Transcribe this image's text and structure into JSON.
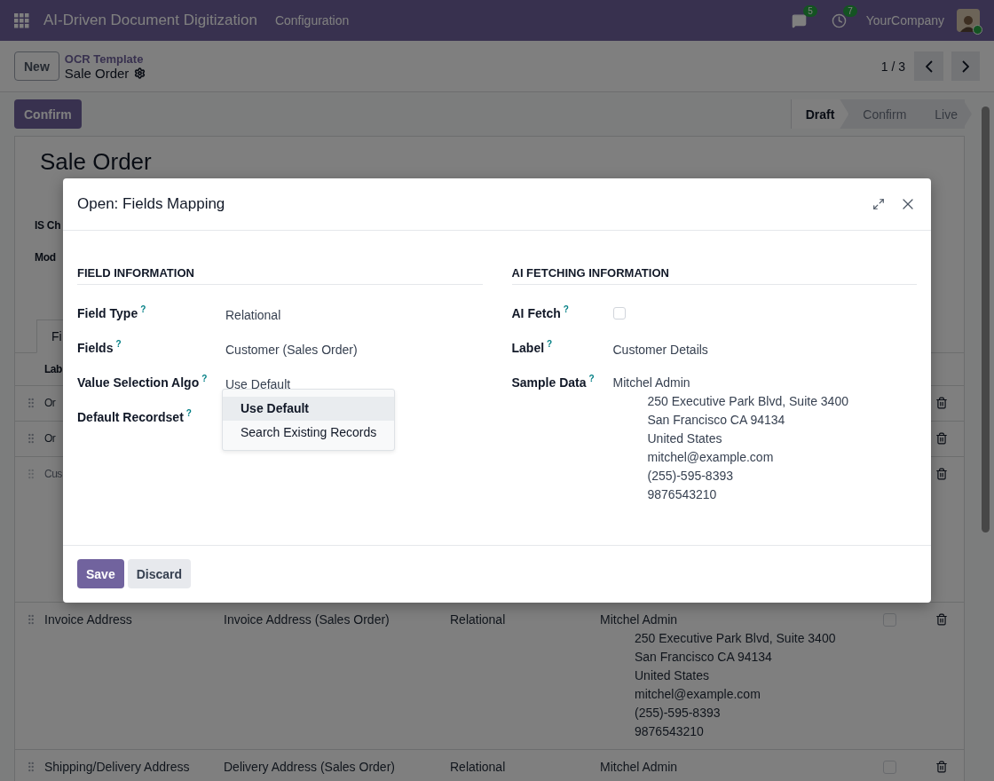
{
  "navbar": {
    "app_title": "AI-Driven Document Digitization",
    "menus": [
      "Configuration"
    ],
    "messages_badge": "5",
    "activities_badge": "7",
    "company": "YourCompany"
  },
  "control_panel": {
    "new_button": "New",
    "breadcrumb_parent": "OCR Template",
    "breadcrumb_current": "Sale Order",
    "pager": "1 / 3"
  },
  "status_bar": {
    "buttons": [
      "Confirm"
    ],
    "stages": [
      {
        "label": "Draft",
        "selected": true
      },
      {
        "label": "Confirm",
        "selected": false
      },
      {
        "label": "Live",
        "selected": false
      }
    ]
  },
  "sheet": {
    "title": "Sale Order",
    "fields": [
      "IS Ch",
      "Mod"
    ],
    "tabs": [
      {
        "label": "Fi",
        "selected": true
      }
    ],
    "table": {
      "columns": [
        "Lab"
      ],
      "rows": [
        {
          "kind": "short",
          "label": "Or",
          "muted": false
        },
        {
          "kind": "short",
          "label": "Or",
          "muted": false
        },
        {
          "kind": "covered",
          "label": "Cus",
          "muted": true
        },
        {
          "kind": "full",
          "label": "Invoice Address",
          "field": "Invoice Address (Sales Order)",
          "type": "Relational",
          "sample_name": "Mitchel Admin",
          "sample_lines": [
            "250 Executive Park Blvd, Suite 3400",
            "San Francisco CA 94134",
            "United States",
            "mitchel@example.com",
            "(255)-595-8393",
            "9876543210"
          ],
          "ai_fetch": false,
          "muted": false
        },
        {
          "kind": "full",
          "label": "Shipping/Delivery Address",
          "field": "Delivery Address (Sales Order)",
          "type": "Relational",
          "sample_name": "Mitchel Admin",
          "sample_lines": [],
          "ai_fetch": false,
          "muted": false
        }
      ]
    }
  },
  "dialog": {
    "title": "Open: Fields Mapping",
    "sections": [
      {
        "heading": "FIELD INFORMATION",
        "rows": [
          {
            "kind": "text",
            "label": "Field Type",
            "help": "?",
            "value": "Relational"
          },
          {
            "kind": "text",
            "label": "Fields",
            "help": "?",
            "value": "Customer (Sales Order)"
          },
          {
            "kind": "text",
            "label": "Value Selection Algo",
            "help": "?",
            "value": "Use Default"
          },
          {
            "kind": "select",
            "label": "Default Recordset",
            "help": "?",
            "options": [
              {
                "label": "Use Default",
                "selected": true
              },
              {
                "label": "Search Existing Records",
                "selected": false
              }
            ]
          }
        ]
      },
      {
        "heading": "AI FETCHING INFORMATION",
        "rows": [
          {
            "kind": "checkbox",
            "label": "AI Fetch",
            "help": "?",
            "checked": false
          },
          {
            "kind": "text",
            "label": "Label",
            "help": "?",
            "value": "Customer Details"
          },
          {
            "kind": "address",
            "label": "Sample Data",
            "help": "?",
            "name": "Mitchel Admin",
            "lines": [
              "250 Executive Park Blvd, Suite 3400",
              "San Francisco CA 94134",
              "United States",
              "mitchel@example.com",
              "(255)-595-8393",
              "9876543210"
            ]
          }
        ]
      }
    ],
    "buttons": [
      {
        "label": "Save",
        "kind": "primary"
      },
      {
        "label": "Discard",
        "kind": "secondary"
      }
    ]
  }
}
